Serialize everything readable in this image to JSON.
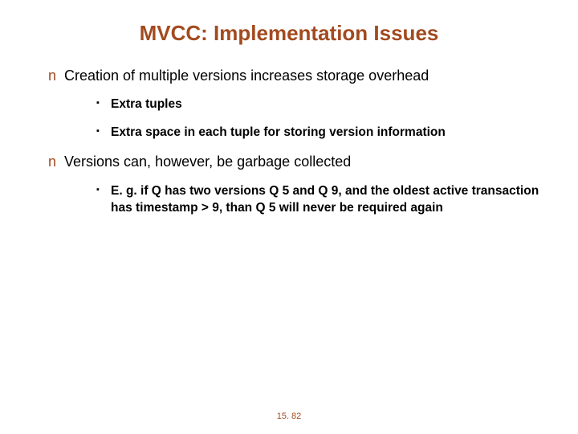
{
  "title": "MVCC: Implementation Issues",
  "bullets": {
    "b1": {
      "marker": "n",
      "text": "Creation of multiple versions increases storage overhead",
      "subs": {
        "s1": {
          "marker": "▪",
          "text": "Extra tuples"
        },
        "s2": {
          "marker": "▪",
          "text": "Extra space in each tuple for storing version information"
        }
      }
    },
    "b2": {
      "marker": "n",
      "text": "Versions can, however, be garbage collected",
      "subs": {
        "s1": {
          "marker": "▪",
          "text": "E. g. if Q has two versions Q 5 and Q 9, and the oldest active transaction has timestamp > 9, than Q 5 will never be required again"
        }
      }
    }
  },
  "footer": "15. 82"
}
